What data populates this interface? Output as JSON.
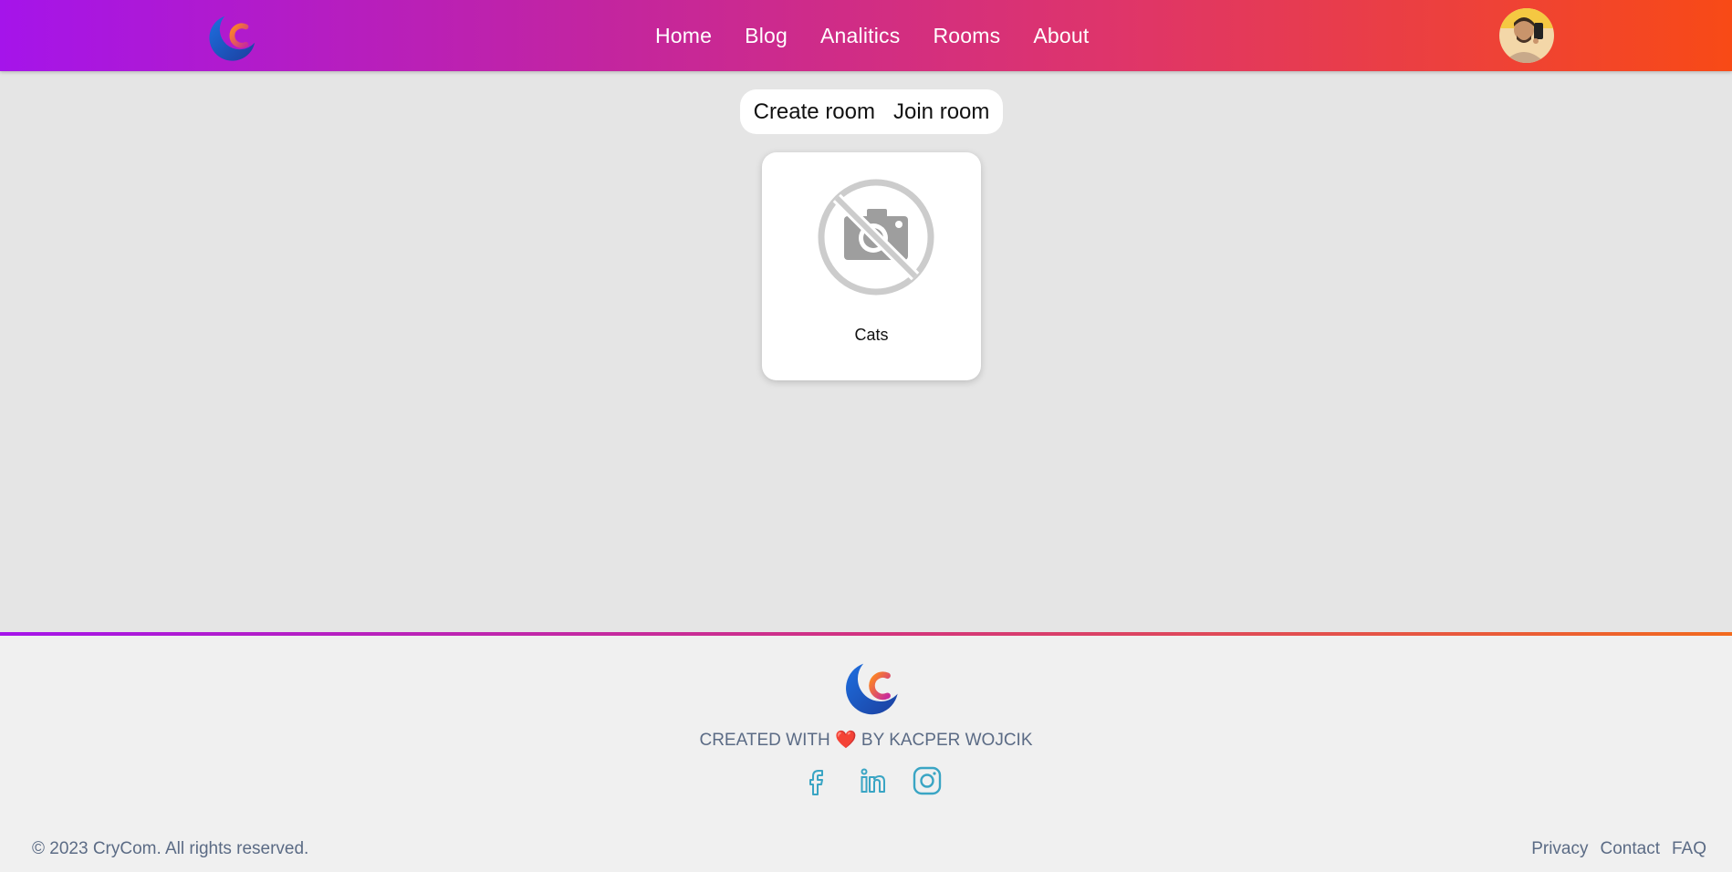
{
  "brand": {
    "logo_icon": "crycom-logo-icon"
  },
  "nav": {
    "items": [
      {
        "label": "Home"
      },
      {
        "label": "Blog"
      },
      {
        "label": "Analitics"
      },
      {
        "label": "Rooms"
      },
      {
        "label": "About"
      }
    ]
  },
  "user": {
    "avatar_icon": "user-avatar"
  },
  "rooms": {
    "create_label": "Create room",
    "join_label": "Join room",
    "cards": [
      {
        "name": "Cats",
        "image_icon": "no-camera-icon"
      }
    ]
  },
  "footer": {
    "credit_prefix": "CREATED WITH",
    "credit_heart": "❤️",
    "credit_suffix": "BY KACPER WOJCIK",
    "socials": [
      {
        "icon": "facebook-icon"
      },
      {
        "icon": "linkedin-icon"
      },
      {
        "icon": "instagram-icon"
      }
    ],
    "copyright": "© 2023 CryCom. All rights reserved.",
    "links": [
      {
        "label": "Privacy"
      },
      {
        "label": "Contact"
      },
      {
        "label": "FAQ"
      }
    ]
  },
  "colors": {
    "header_gradient": [
      "#a514ea",
      "#c3259f",
      "#df3569",
      "#f84a16"
    ],
    "page_background": "#e5e5e5",
    "footer_text": "#5b6b85",
    "social_icon": "#3aa5c4"
  }
}
